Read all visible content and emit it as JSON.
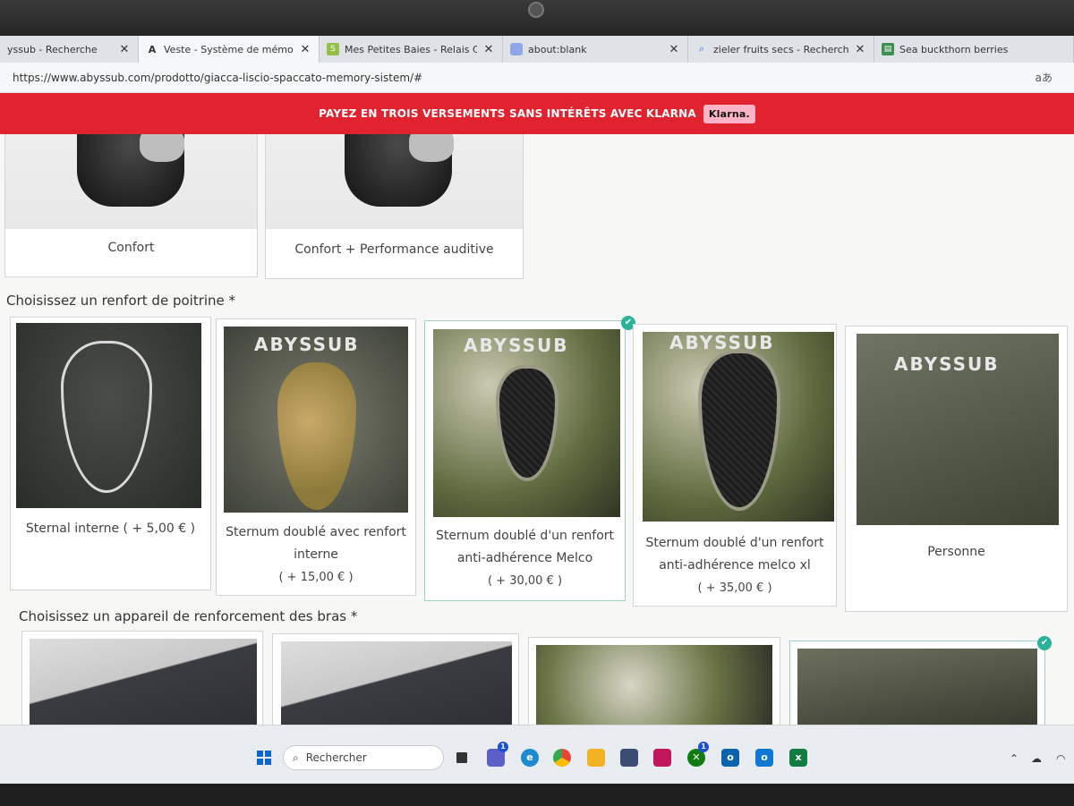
{
  "tabs": [
    {
      "title": "yssub - Recherche",
      "icon": "search-icon"
    },
    {
      "title": "Veste - Système de mémoire Sn",
      "icon": "abyssub-logo-icon"
    },
    {
      "title": "Mes Petites Baies - Relais Colis",
      "icon": "shopify-icon"
    },
    {
      "title": "about:blank",
      "icon": "blank-page-icon"
    },
    {
      "title": "zieler fruits secs - Recherche",
      "icon": "search-icon"
    },
    {
      "title": "Sea buckthorn berries",
      "icon": "sheet-icon"
    }
  ],
  "address": "https://www.abyssub.com/prodotto/giacca-liscio-spaccato-memory-sistem/#",
  "translate_label": "aあ",
  "promo": {
    "text": "PAYEZ EN TROIS VERSEMENTS SANS INTÉRÊTS AVEC KLARNA",
    "badge": "Klarna."
  },
  "hood_options": [
    {
      "label": "Confort"
    },
    {
      "label": "Confort + Performance auditive"
    }
  ],
  "chest_section": {
    "title": "Choisissez un renfort de poitrine *",
    "brand": "ABYSSUB",
    "options": [
      {
        "line1": "Sternal interne ( + 5,00  € )",
        "line2": "",
        "line3": "",
        "selected": false
      },
      {
        "line1": "Sternum doublé avec renfort",
        "line2": "interne",
        "line3": "( + 15,00  € )",
        "selected": false
      },
      {
        "line1": "Sternum doublé d'un renfort",
        "line2": "anti-adhérence Melco",
        "line3": "( + 30,00  € )",
        "selected": true
      },
      {
        "line1": "Sternum doublé d'un renfort",
        "line2": "anti-adhérence melco xl",
        "line3": "( + 35,00  € )",
        "selected": false
      },
      {
        "line1": "Personne",
        "line2": "",
        "line3": "",
        "selected": false
      }
    ]
  },
  "arm_section": {
    "title": "Choisissez un appareil de renforcement des bras *",
    "options": [
      {
        "selected": false
      },
      {
        "selected": false
      },
      {
        "selected": false
      },
      {
        "selected": true
      }
    ]
  },
  "taskbar": {
    "search_placeholder": "Rechercher",
    "badge_teams": "1",
    "badge_xbox": "1"
  },
  "colors": {
    "promo": "#e0232e",
    "klarna": "#ffb3c7",
    "check": "#2bb39a"
  }
}
